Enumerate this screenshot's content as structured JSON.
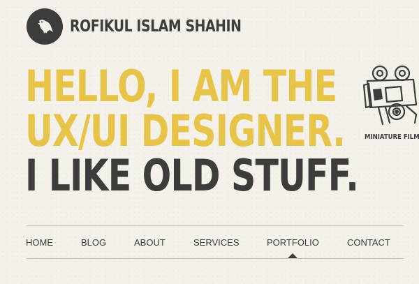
{
  "header": {
    "logo_icon": "crow-icon",
    "site_name": "ROFIKUL ISLAM SHAHIN"
  },
  "hero": {
    "line1": "HELLO, I AM THE",
    "line2": "UX/UI DESIGNER.",
    "line3": "I LIKE OLD STUFF.",
    "accent_color": "#e7c347",
    "text_color": "#3c3c3b"
  },
  "illustration": {
    "icon": "film-camera-icon",
    "caption": "MINIATURE FILM"
  },
  "nav": {
    "items": [
      {
        "label": "HOME"
      },
      {
        "label": "BLOG"
      },
      {
        "label": "ABOUT"
      },
      {
        "label": "SERVICES"
      },
      {
        "label": "PORTFOLIO"
      },
      {
        "label": "CONTACT"
      }
    ],
    "active": "PORTFOLIO"
  }
}
